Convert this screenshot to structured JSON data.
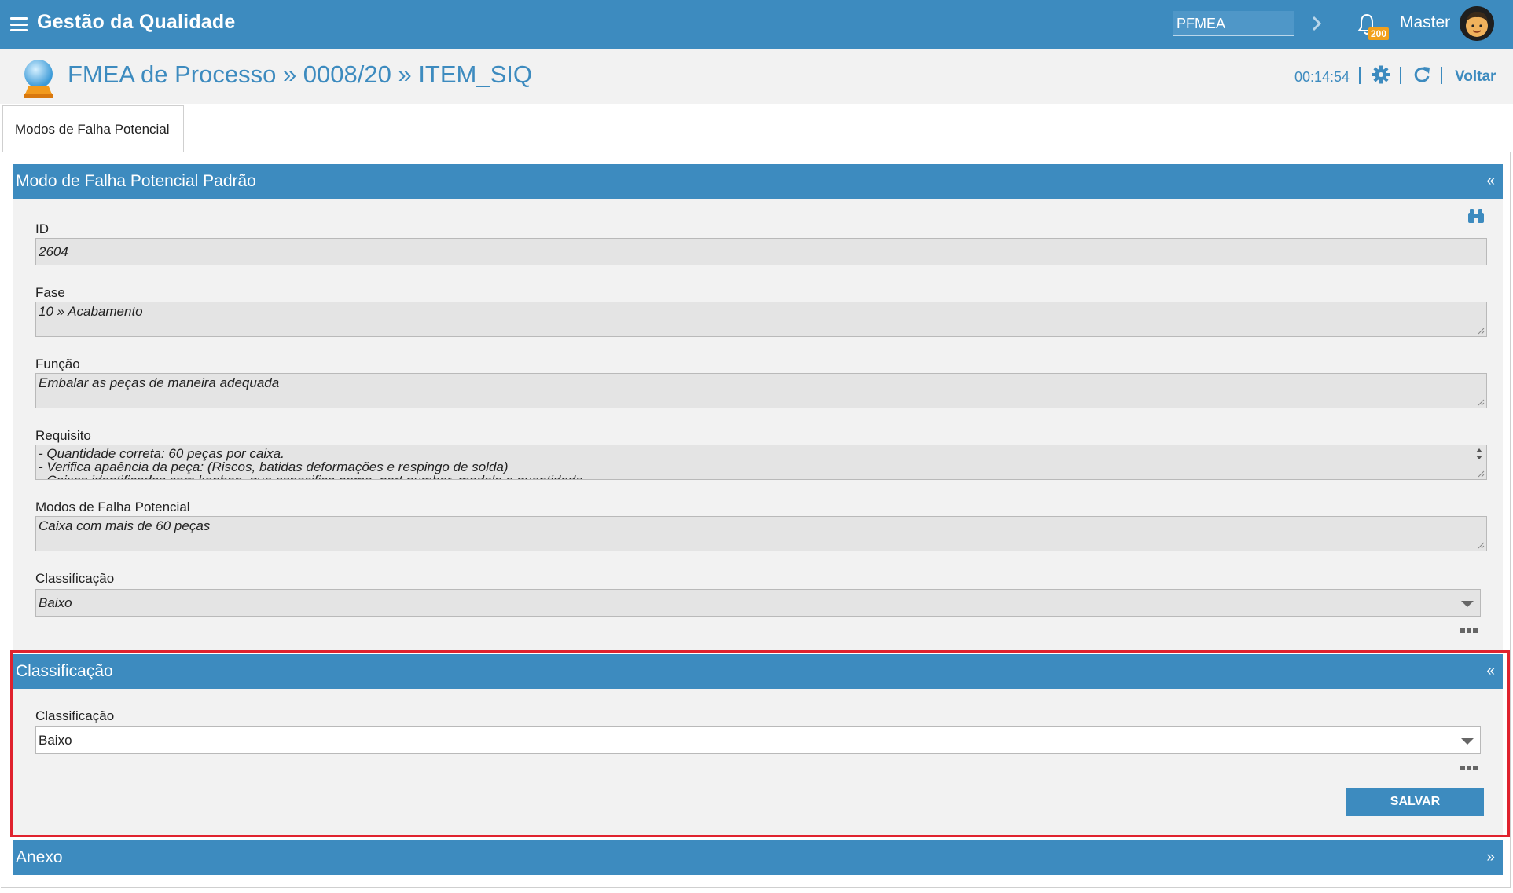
{
  "app": {
    "title": "Gestão da Qualidade"
  },
  "topbar": {
    "module": "PFMEA",
    "notifications_count": "200",
    "user": "Master"
  },
  "page": {
    "title": "FMEA de Processo » 0008/20 » ITEM_SIQ",
    "timer": "00:14:54",
    "back_label": "Voltar"
  },
  "tabs": [
    {
      "label": "Modos de Falha Potencial"
    }
  ],
  "panel_default": {
    "title": "Modo de Falha Potencial Padrão",
    "toggle": "«",
    "fields": {
      "id": {
        "label": "ID",
        "value": "2604"
      },
      "fase": {
        "label": "Fase",
        "value": "10 » Acabamento"
      },
      "funcao": {
        "label": "Função",
        "value": "Embalar as peças de maneira adequada"
      },
      "requisito": {
        "label": "Requisito",
        "line1": "- Quantidade correta: 60 peças por caixa.",
        "line2": "- Verifica apaência da peça: (Riscos, batidas deformações e respingo de solda)",
        "line3": "- Caixas identificadas com kanban, que especifica nome, part number, modelo e quantidade"
      },
      "modos": {
        "label": "Modos de Falha Potencial",
        "value": "Caixa com mais de 60 peças"
      },
      "classificacao": {
        "label": "Classificação",
        "value": "Baixo"
      }
    }
  },
  "panel_classificacao": {
    "title": "Classificação",
    "toggle": "«",
    "field_label": "Classificação",
    "field_value": "Baixo",
    "save_label": "SALVAR"
  },
  "panel_anexo": {
    "title": "Anexo",
    "toggle": "»"
  },
  "colors": {
    "primary": "#3d8bbf",
    "highlight": "#e0222e",
    "badge": "#f2a01b"
  }
}
